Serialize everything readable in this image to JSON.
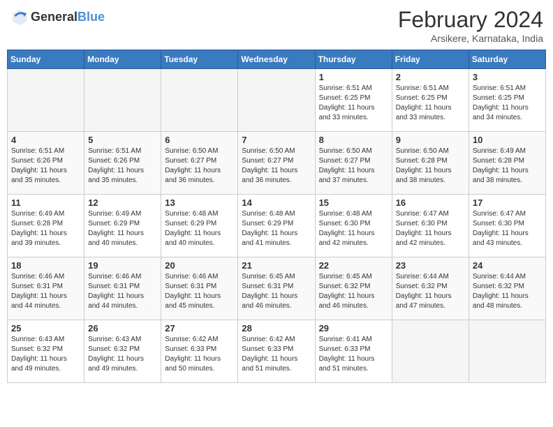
{
  "header": {
    "logo_general": "General",
    "logo_blue": "Blue",
    "title": "February 2024",
    "location": "Arsikere, Karnataka, India"
  },
  "days_of_week": [
    "Sunday",
    "Monday",
    "Tuesday",
    "Wednesday",
    "Thursday",
    "Friday",
    "Saturday"
  ],
  "weeks": [
    [
      {
        "day": "",
        "empty": true
      },
      {
        "day": "",
        "empty": true
      },
      {
        "day": "",
        "empty": true
      },
      {
        "day": "",
        "empty": true
      },
      {
        "day": "1",
        "sunrise": "6:51 AM",
        "sunset": "6:25 PM",
        "daylight": "11 hours and 33 minutes."
      },
      {
        "day": "2",
        "sunrise": "6:51 AM",
        "sunset": "6:25 PM",
        "daylight": "11 hours and 33 minutes."
      },
      {
        "day": "3",
        "sunrise": "6:51 AM",
        "sunset": "6:25 PM",
        "daylight": "11 hours and 34 minutes."
      }
    ],
    [
      {
        "day": "4",
        "sunrise": "6:51 AM",
        "sunset": "6:26 PM",
        "daylight": "11 hours and 35 minutes."
      },
      {
        "day": "5",
        "sunrise": "6:51 AM",
        "sunset": "6:26 PM",
        "daylight": "11 hours and 35 minutes."
      },
      {
        "day": "6",
        "sunrise": "6:50 AM",
        "sunset": "6:27 PM",
        "daylight": "11 hours and 36 minutes."
      },
      {
        "day": "7",
        "sunrise": "6:50 AM",
        "sunset": "6:27 PM",
        "daylight": "11 hours and 36 minutes."
      },
      {
        "day": "8",
        "sunrise": "6:50 AM",
        "sunset": "6:27 PM",
        "daylight": "11 hours and 37 minutes."
      },
      {
        "day": "9",
        "sunrise": "6:50 AM",
        "sunset": "6:28 PM",
        "daylight": "11 hours and 38 minutes."
      },
      {
        "day": "10",
        "sunrise": "6:49 AM",
        "sunset": "6:28 PM",
        "daylight": "11 hours and 38 minutes."
      }
    ],
    [
      {
        "day": "11",
        "sunrise": "6:49 AM",
        "sunset": "6:28 PM",
        "daylight": "11 hours and 39 minutes."
      },
      {
        "day": "12",
        "sunrise": "6:49 AM",
        "sunset": "6:29 PM",
        "daylight": "11 hours and 40 minutes."
      },
      {
        "day": "13",
        "sunrise": "6:48 AM",
        "sunset": "6:29 PM",
        "daylight": "11 hours and 40 minutes."
      },
      {
        "day": "14",
        "sunrise": "6:48 AM",
        "sunset": "6:29 PM",
        "daylight": "11 hours and 41 minutes."
      },
      {
        "day": "15",
        "sunrise": "6:48 AM",
        "sunset": "6:30 PM",
        "daylight": "11 hours and 42 minutes."
      },
      {
        "day": "16",
        "sunrise": "6:47 AM",
        "sunset": "6:30 PM",
        "daylight": "11 hours and 42 minutes."
      },
      {
        "day": "17",
        "sunrise": "6:47 AM",
        "sunset": "6:30 PM",
        "daylight": "11 hours and 43 minutes."
      }
    ],
    [
      {
        "day": "18",
        "sunrise": "6:46 AM",
        "sunset": "6:31 PM",
        "daylight": "11 hours and 44 minutes."
      },
      {
        "day": "19",
        "sunrise": "6:46 AM",
        "sunset": "6:31 PM",
        "daylight": "11 hours and 44 minutes."
      },
      {
        "day": "20",
        "sunrise": "6:46 AM",
        "sunset": "6:31 PM",
        "daylight": "11 hours and 45 minutes."
      },
      {
        "day": "21",
        "sunrise": "6:45 AM",
        "sunset": "6:31 PM",
        "daylight": "11 hours and 46 minutes."
      },
      {
        "day": "22",
        "sunrise": "6:45 AM",
        "sunset": "6:32 PM",
        "daylight": "11 hours and 46 minutes."
      },
      {
        "day": "23",
        "sunrise": "6:44 AM",
        "sunset": "6:32 PM",
        "daylight": "11 hours and 47 minutes."
      },
      {
        "day": "24",
        "sunrise": "6:44 AM",
        "sunset": "6:32 PM",
        "daylight": "11 hours and 48 minutes."
      }
    ],
    [
      {
        "day": "25",
        "sunrise": "6:43 AM",
        "sunset": "6:32 PM",
        "daylight": "11 hours and 49 minutes."
      },
      {
        "day": "26",
        "sunrise": "6:43 AM",
        "sunset": "6:32 PM",
        "daylight": "11 hours and 49 minutes."
      },
      {
        "day": "27",
        "sunrise": "6:42 AM",
        "sunset": "6:33 PM",
        "daylight": "11 hours and 50 minutes."
      },
      {
        "day": "28",
        "sunrise": "6:42 AM",
        "sunset": "6:33 PM",
        "daylight": "11 hours and 51 minutes."
      },
      {
        "day": "29",
        "sunrise": "6:41 AM",
        "sunset": "6:33 PM",
        "daylight": "11 hours and 51 minutes."
      },
      {
        "day": "",
        "empty": true
      },
      {
        "day": "",
        "empty": true
      }
    ]
  ]
}
